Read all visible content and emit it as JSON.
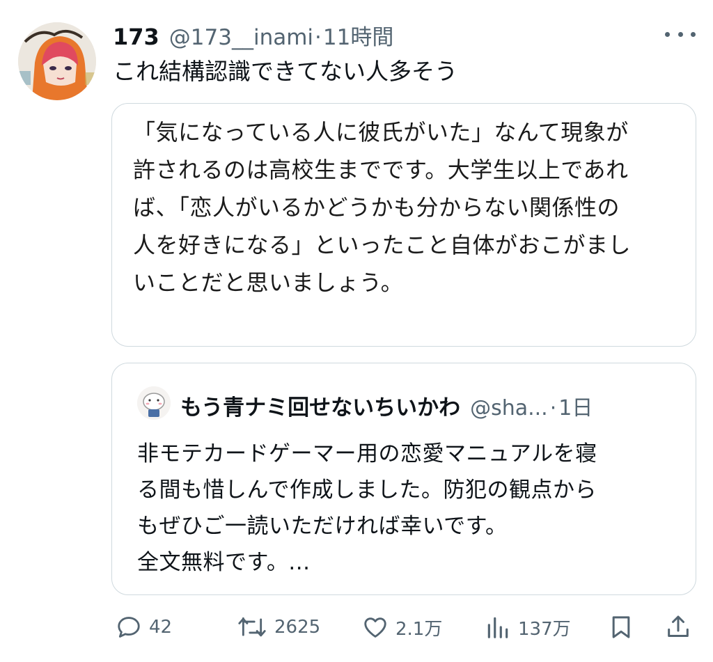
{
  "tweet": {
    "display_name": "173",
    "handle": "@173__inami",
    "separator": "·",
    "time": "11時間",
    "text": "これ結構認識できてない人多そう",
    "image_text_lines": [
      "「気になっている人に彼氏がいた」なんて現象が",
      "許されるのは高校生までです。大学生以上であれ",
      "ば、「恋人がいるかどうかも分からない関係性の",
      "人を好きになる」といったこと自体がおこがまし",
      "いことだと思いましょう。"
    ]
  },
  "quote": {
    "display_name": "もう青ナミ回せないちいかわ",
    "handle": "@sha...",
    "separator": "·",
    "time": "1日",
    "text_lines": [
      "非モテカードゲーマー用の恋愛マニュアルを寝",
      "る間も惜しんで作成しました。防犯の観点から",
      "もぜひご一読いただければ幸いです。",
      "全文無料です。..."
    ]
  },
  "actions": {
    "reply_count": "42",
    "retweet_count": "2625",
    "like_count": "2.1万",
    "views_count": "137万"
  },
  "colors": {
    "text_primary": "#0f1419",
    "text_secondary": "#536471",
    "border": "#cfd9de",
    "avatar_accent": "#e8772c"
  }
}
